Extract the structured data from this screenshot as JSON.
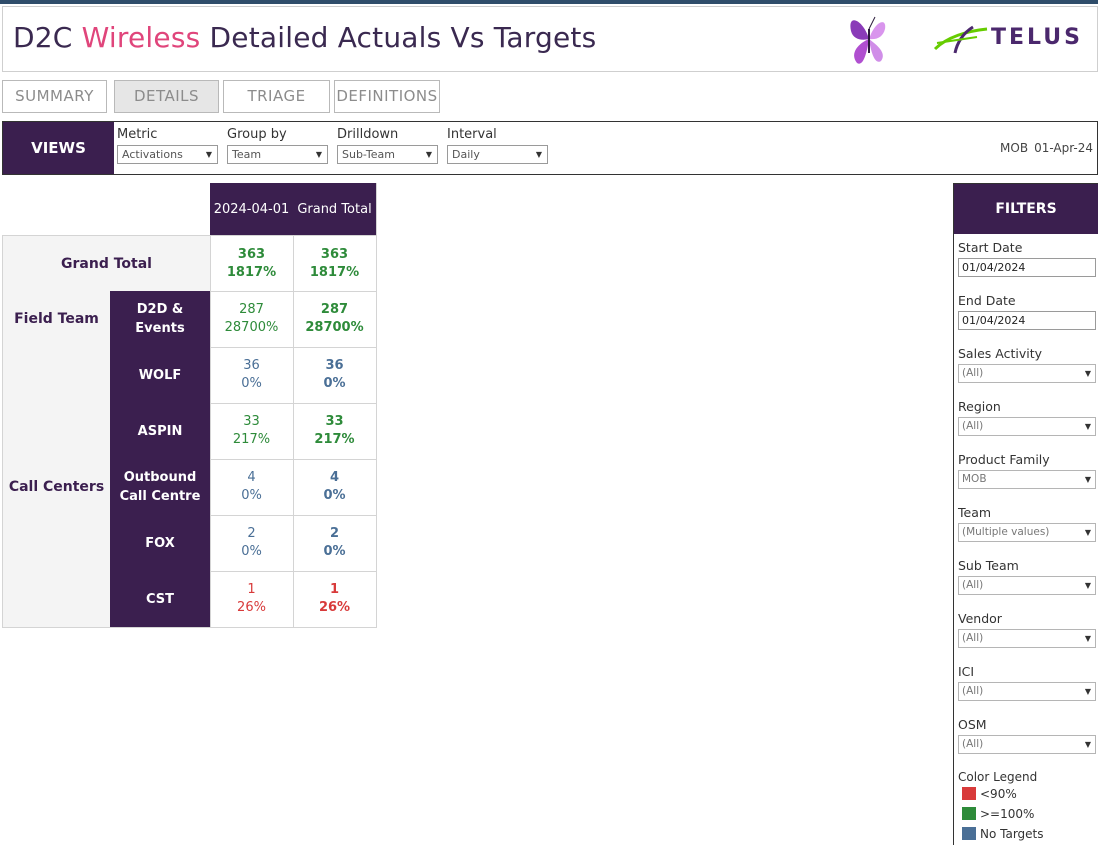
{
  "header": {
    "title_part1": "D2C ",
    "title_accent": "Wireless",
    "title_part2": " Detailed Actuals Vs Targets",
    "logo_text": "TELUS",
    "accent_color": "#e0457b",
    "brand_color": "#3b1f4f"
  },
  "tabs": [
    {
      "label": "SUMMARY",
      "active": false
    },
    {
      "label": "DETAILS",
      "active": true
    },
    {
      "label": "TRIAGE",
      "active": false
    },
    {
      "label": "DEFINITIONS",
      "active": false
    }
  ],
  "views": {
    "label": "VIEWS",
    "metric": {
      "label": "Metric",
      "value": "Activations"
    },
    "group_by": {
      "label": "Group by",
      "value": "Team"
    },
    "drilldown": {
      "label": "Drilldown",
      "value": "Sub-Team"
    },
    "interval": {
      "label": "Interval",
      "value": "Daily"
    },
    "product": "MOB",
    "date": "01-Apr-24"
  },
  "table": {
    "columns": [
      "2024-04-01",
      "Grand Total"
    ],
    "grand_total": {
      "label": "Grand Total",
      "cells": [
        [
          "363",
          "1817%"
        ],
        [
          "363",
          "1817%"
        ]
      ],
      "status": "green"
    },
    "field_team": {
      "label": "Field Team",
      "rows": [
        {
          "label": "D2D & Events",
          "cells": [
            [
              "287",
              "28700%"
            ],
            [
              "287",
              "28700%"
            ]
          ],
          "status": "green"
        }
      ]
    },
    "call_centers": {
      "label": "Call Centers",
      "rows": [
        {
          "label": "WOLF",
          "cells": [
            [
              "36",
              "0%"
            ],
            [
              "36",
              "0%"
            ]
          ],
          "status": "blue"
        },
        {
          "label": "ASPIN",
          "cells": [
            [
              "33",
              "217%"
            ],
            [
              "33",
              "217%"
            ]
          ],
          "status": "green"
        },
        {
          "label": "Outbound Call Centre",
          "cells": [
            [
              "4",
              "0%"
            ],
            [
              "4",
              "0%"
            ]
          ],
          "status": "blue"
        },
        {
          "label": "FOX",
          "cells": [
            [
              "2",
              "0%"
            ],
            [
              "2",
              "0%"
            ]
          ],
          "status": "blue"
        },
        {
          "label": "CST",
          "cells": [
            [
              "1",
              "26%"
            ],
            [
              "1",
              "26%"
            ]
          ],
          "status": "red"
        }
      ]
    }
  },
  "filters": {
    "title": "FILTERS",
    "start_date": {
      "label": "Start Date",
      "value": "01/04/2024"
    },
    "end_date": {
      "label": "End Date",
      "value": "01/04/2024"
    },
    "dropdowns": [
      {
        "label": "Sales Activity",
        "value": "(All)"
      },
      {
        "label": "Region",
        "value": "(All)"
      },
      {
        "label": "Product Family",
        "value": "MOB"
      },
      {
        "label": "Team",
        "value": "(Multiple values)"
      },
      {
        "label": "Sub Team",
        "value": "(All)"
      },
      {
        "label": "Vendor",
        "value": "(All)"
      },
      {
        "label": "ICI",
        "value": "(All)"
      },
      {
        "label": "OSM",
        "value": "(All)"
      }
    ],
    "legend": {
      "title": "Color Legend",
      "items": [
        {
          "label": "<90%",
          "color": "#d83a3a"
        },
        {
          "label": ">=100%",
          "color": "#2e8b3a"
        },
        {
          "label": "No Targets",
          "color": "#4a6f96"
        }
      ]
    }
  }
}
